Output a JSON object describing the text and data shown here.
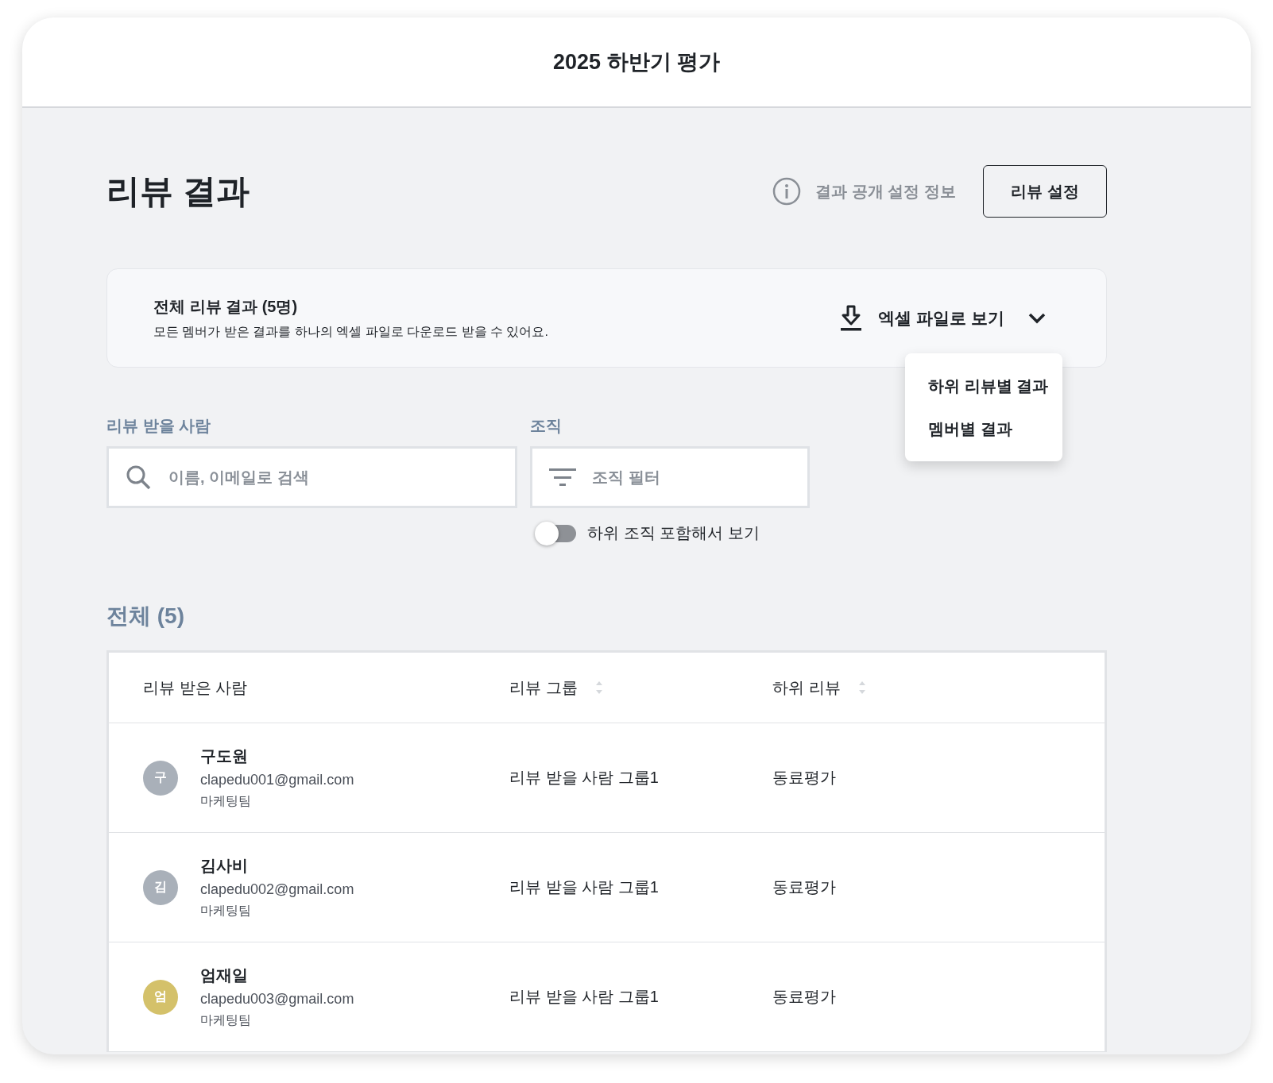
{
  "window": {
    "title": "2025 하반기 평가"
  },
  "page": {
    "title": "리뷰 결과",
    "info_link": "결과 공개 설정 정보",
    "settings_button": "리뷰 설정"
  },
  "summary": {
    "title": "전체 리뷰 결과 (5명)",
    "description": "모든 멤버가 받은 결과를 하나의 엑셀 파일로 다운로드 받을 수 있어요.",
    "excel_button": "엑셀 파일로 보기",
    "expanded": true,
    "menu": [
      "하위 리뷰별 결과",
      "멤버별 결과"
    ]
  },
  "filters": {
    "reviewee_label": "리뷰 받을 사람",
    "search_placeholder": "이름, 이메일로 검색",
    "org_label": "조직",
    "org_placeholder": "조직 필터",
    "include_sub": {
      "label": "하위 조직 포함해서 보기",
      "on": false
    }
  },
  "list": {
    "heading": "전체 (5)",
    "columns": [
      {
        "label": "리뷰 받은 사람",
        "sortable": false
      },
      {
        "label": "리뷰 그룹",
        "sortable": true
      },
      {
        "label": "하위 리뷰",
        "sortable": true
      }
    ],
    "rows": [
      {
        "initial": "구",
        "color": "#a9b0b9",
        "name": "구도원",
        "email": "clapedu001@gmail.com",
        "team": "마케팅팀",
        "group": "리뷰 받을 사람 그룹1",
        "sub_review": "동료평가"
      },
      {
        "initial": "김",
        "color": "#a9b0b9",
        "name": "김사비",
        "email": "clapedu002@gmail.com",
        "team": "마케팅팀",
        "group": "리뷰 받을 사람 그룹1",
        "sub_review": "동료평가"
      },
      {
        "initial": "엄",
        "color": "#d4c16a",
        "name": "엄재일",
        "email": "clapedu003@gmail.com",
        "team": "마케팅팀",
        "group": "리뷰 받을 사람 그룹1",
        "sub_review": "동료평가"
      }
    ]
  }
}
